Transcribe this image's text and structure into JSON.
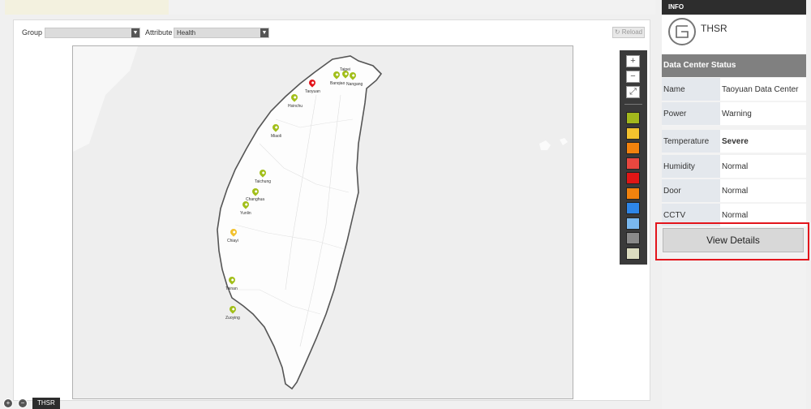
{
  "toolbar": {
    "group_label": "Group",
    "group_value": "",
    "attribute_label": "Attribute",
    "attribute_value": "Health",
    "reload_label": "Reload",
    "reload_icon": "refresh-icon"
  },
  "map": {
    "stations": [
      {
        "name": "Taipei",
        "color": "#a2bf1a"
      },
      {
        "name": "Banqiao",
        "color": "#a2bf1a"
      },
      {
        "name": "Nangang",
        "color": "#a2bf1a"
      },
      {
        "name": "Taoyuan",
        "color": "#e3151c"
      },
      {
        "name": "Hsinchu",
        "color": "#a2bf1a"
      },
      {
        "name": "Miaoli",
        "color": "#a2bf1a"
      },
      {
        "name": "Taichung",
        "color": "#a2bf1a"
      },
      {
        "name": "Changhua",
        "color": "#a2bf1a"
      },
      {
        "name": "Yunlin",
        "color": "#a2bf1a"
      },
      {
        "name": "Chiayi",
        "color": "#f2c12e"
      },
      {
        "name": "Tainan",
        "color": "#a2bf1a"
      },
      {
        "name": "Zuoying",
        "color": "#a2bf1a"
      }
    ],
    "controls": {
      "zoom_in": "+",
      "zoom_out": "−",
      "fullscreen": "⤢"
    },
    "legend_colors": [
      "#a2b81c",
      "#f2c12e",
      "#f2820d",
      "#e8473f",
      "#e01616",
      "#f2820d",
      "#2e86e8",
      "#7ab8ef",
      "#8a8a8a",
      "#dcdcc0"
    ]
  },
  "info": {
    "header": "INFO",
    "title": "THSR",
    "logo_icon": "thsr-logo-icon",
    "section_title": "Data Center Status",
    "rows": [
      {
        "key": "Name",
        "value": "Taoyuan Data Center"
      },
      {
        "key": "Power",
        "value": "Warning"
      },
      {
        "key": "Temperature",
        "value": "Severe"
      },
      {
        "key": "Humidity",
        "value": "Normal"
      },
      {
        "key": "Door",
        "value": "Normal"
      },
      {
        "key": "CCTV",
        "value": "Normal"
      }
    ],
    "view_details_label": "View Details"
  },
  "bottom": {
    "tab_label": "THSR"
  }
}
